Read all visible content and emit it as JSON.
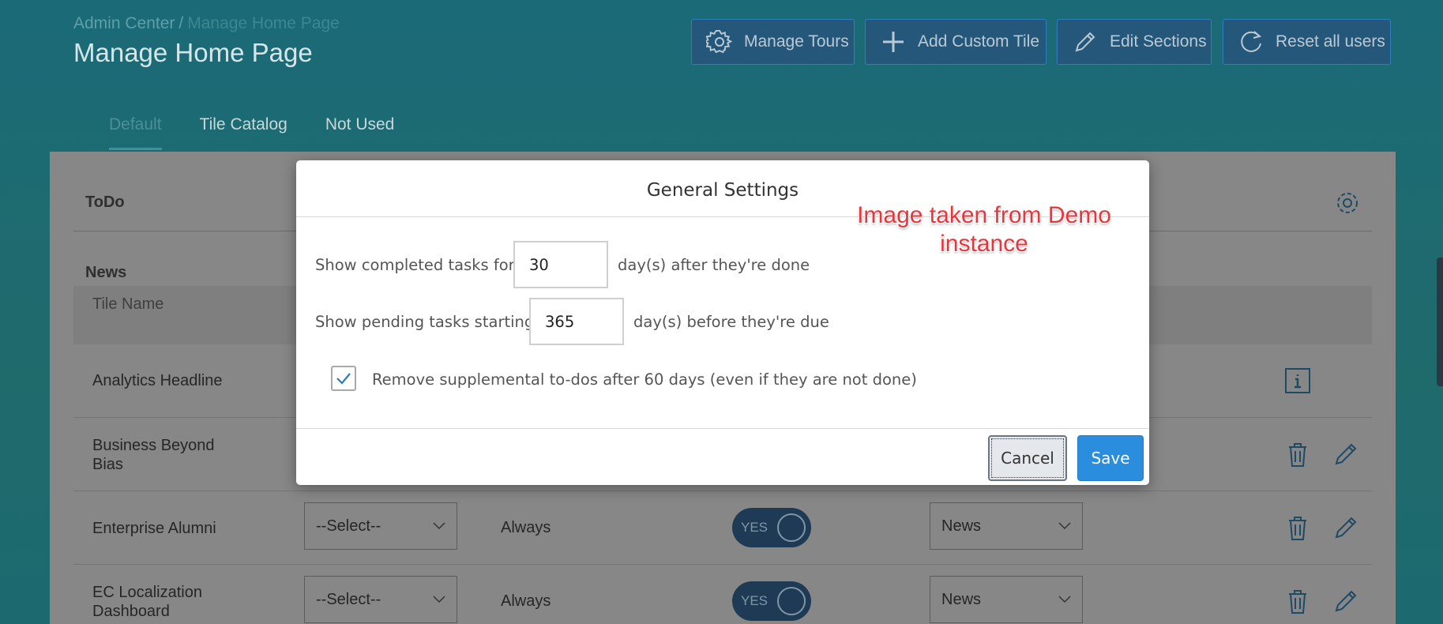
{
  "header": {
    "breadcrumb_root": "Admin Center",
    "breadcrumb_sep": "/",
    "breadcrumb_current": "Manage Home Page",
    "title": "Manage Home Page",
    "buttons": {
      "manage_tours": "Manage Tours",
      "add_custom_tile": "Add Custom Tile",
      "edit_sections": "Edit Sections",
      "reset_all_users": "Reset all users"
    }
  },
  "tabs": [
    {
      "label": "Default",
      "active": true
    },
    {
      "label": "Tile Catalog",
      "active": false
    },
    {
      "label": "Not Used",
      "active": false
    }
  ],
  "panel": {
    "todo_label": "ToDo",
    "news_label": "News",
    "column_tile_name": "Tile Name",
    "rows": [
      {
        "name": "Analytics Headline"
      },
      {
        "name": "Business Beyond Bias"
      },
      {
        "name": "Enterprise Alumni",
        "select": "--Select--",
        "visibility": "Always",
        "toggle": "YES",
        "section": "News"
      },
      {
        "name": "EC Localization Dashboard",
        "select": "--Select--",
        "visibility": "Always",
        "toggle": "YES",
        "section": "News"
      }
    ]
  },
  "modal": {
    "title": "General Settings",
    "completed_label": "Show completed tasks for",
    "completed_value": "30",
    "completed_suffix": "day(s) after they're done",
    "pending_label": "Show pending tasks starting",
    "pending_value": "365",
    "pending_suffix": "day(s) before they're due",
    "supplemental_label": "Remove supplemental to-dos after 60 days (even if they are not done)",
    "supplemental_checked": true,
    "cancel_label": "Cancel",
    "save_label": "Save"
  },
  "watermark": {
    "line1": "Image taken from Demo",
    "line2": "instance"
  },
  "colors": {
    "save_blue": "#2a8ddd",
    "header_button": "#24577a",
    "watermark_red": "#e8343b"
  }
}
